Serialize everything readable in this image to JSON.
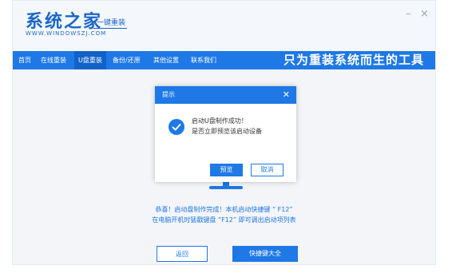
{
  "header": {
    "title": "系统之家",
    "tagline": "一键重装",
    "url": "WWW.WINDOWSZJ.COM",
    "minimize": "–",
    "close": "×"
  },
  "nav": {
    "items": [
      {
        "label": "首页"
      },
      {
        "label": "在线重装"
      },
      {
        "label": "U盘重装"
      },
      {
        "label": "备份/还原"
      },
      {
        "label": "其他设置"
      },
      {
        "label": "联系我们"
      }
    ],
    "active": "U盘重装",
    "slogan": "只为重装系统而生的工具"
  },
  "main": {
    "info_line1": "恭喜！启动盘制作完成！本机启动快捷键 “ F12”",
    "info_line2": "在电脑开机时猛戳键盘 “F12” 即可调出启动项列表",
    "back_button": "返回",
    "hotkey_button": "快捷键大全"
  },
  "dialog": {
    "title": "提示",
    "close": "✕",
    "message_line1": "启动U盘制作成功！",
    "message_line2": "是否立即预览该启动设备",
    "preview_button": "预览",
    "cancel_button": "取消"
  },
  "colors": {
    "accent": "#1e78e6",
    "nav_active": "#1162c8",
    "background": "#f3f5f8"
  },
  "icons": {
    "dialog_status": "check-circle-icon"
  }
}
